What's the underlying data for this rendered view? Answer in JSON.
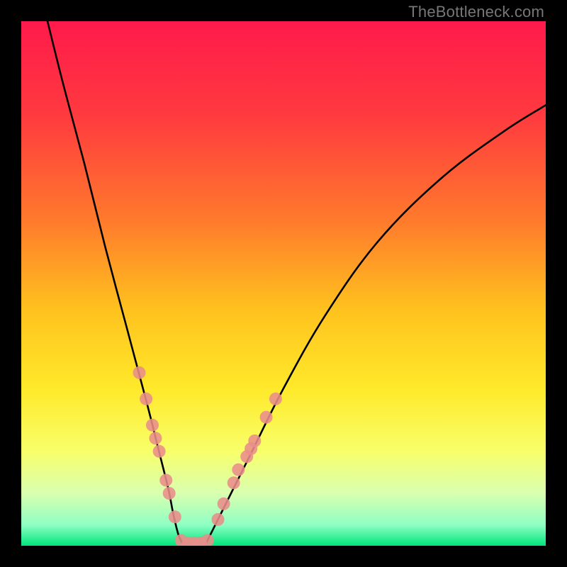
{
  "watermark": {
    "text": "TheBottleneck.com"
  },
  "chart_data": {
    "type": "line",
    "title": "",
    "xlabel": "",
    "ylabel": "",
    "xlim": [
      0,
      100
    ],
    "ylim": [
      0,
      100
    ],
    "grid": false,
    "legend": false,
    "gradient_stops": [
      {
        "offset": 0,
        "color": "#ff1a4b"
      },
      {
        "offset": 0.18,
        "color": "#ff3a3f"
      },
      {
        "offset": 0.38,
        "color": "#ff7a2c"
      },
      {
        "offset": 0.55,
        "color": "#ffc21e"
      },
      {
        "offset": 0.7,
        "color": "#ffe92a"
      },
      {
        "offset": 0.82,
        "color": "#f8ff6a"
      },
      {
        "offset": 0.9,
        "color": "#d9ffb0"
      },
      {
        "offset": 0.96,
        "color": "#8fffc4"
      },
      {
        "offset": 1.0,
        "color": "#00e57a"
      }
    ],
    "series": [
      {
        "name": "left-branch",
        "x": [
          5,
          8,
          12,
          16,
          20,
          24,
          26,
          28,
          29,
          30,
          31
        ],
        "y": [
          100,
          88,
          73,
          57,
          42,
          27,
          19,
          11,
          6,
          2,
          0
        ]
      },
      {
        "name": "right-branch",
        "x": [
          35,
          37,
          40,
          44,
          50,
          58,
          68,
          80,
          92,
          100
        ],
        "y": [
          0,
          4,
          10,
          18,
          30,
          44,
          58,
          70,
          79,
          84
        ]
      }
    ],
    "scatter": {
      "name": "markers",
      "color": "#e98d8a",
      "radius": 9,
      "points": [
        {
          "x": 22.5,
          "y": 33
        },
        {
          "x": 23.8,
          "y": 28
        },
        {
          "x": 25.0,
          "y": 23
        },
        {
          "x": 25.6,
          "y": 20.5
        },
        {
          "x": 26.3,
          "y": 18
        },
        {
          "x": 27.6,
          "y": 12.5
        },
        {
          "x": 28.2,
          "y": 10
        },
        {
          "x": 29.3,
          "y": 5.5
        },
        {
          "x": 30.5,
          "y": 1
        },
        {
          "x": 31.8,
          "y": 0.5
        },
        {
          "x": 33.0,
          "y": 0.5
        },
        {
          "x": 34.2,
          "y": 0.5
        },
        {
          "x": 35.5,
          "y": 1
        },
        {
          "x": 37.5,
          "y": 5
        },
        {
          "x": 38.6,
          "y": 8
        },
        {
          "x": 40.5,
          "y": 12
        },
        {
          "x": 41.4,
          "y": 14.5
        },
        {
          "x": 43.0,
          "y": 17
        },
        {
          "x": 43.8,
          "y": 18.5
        },
        {
          "x": 44.5,
          "y": 20
        },
        {
          "x": 46.7,
          "y": 24.5
        },
        {
          "x": 48.5,
          "y": 28
        }
      ]
    }
  }
}
